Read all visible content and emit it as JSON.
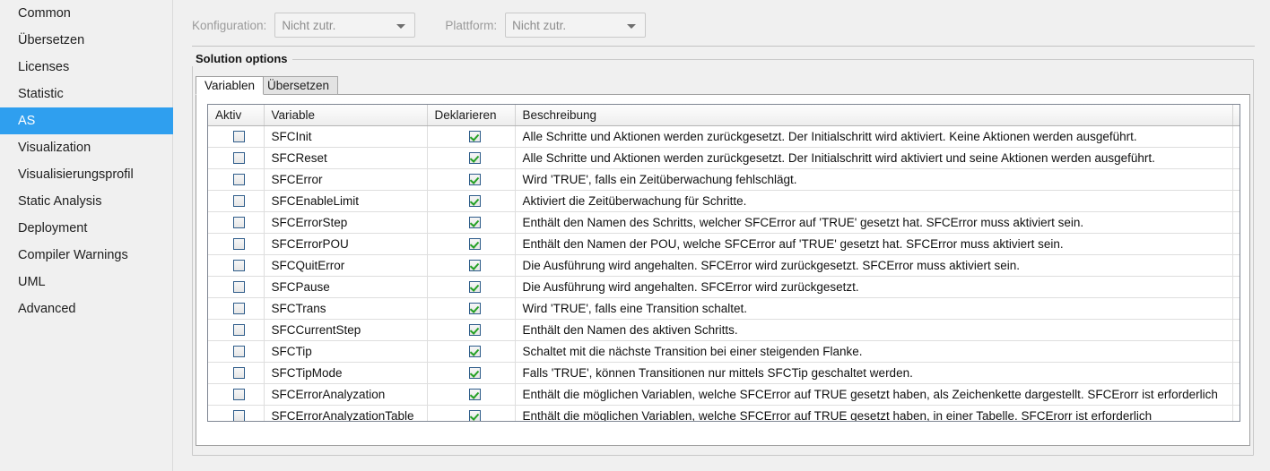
{
  "sidebar": {
    "items": [
      {
        "label": "Common",
        "selected": false
      },
      {
        "label": "Übersetzen",
        "selected": false
      },
      {
        "label": "Licenses",
        "selected": false
      },
      {
        "label": "Statistic",
        "selected": false
      },
      {
        "label": "AS",
        "selected": true
      },
      {
        "label": "Visualization",
        "selected": false
      },
      {
        "label": "Visualisierungsprofil",
        "selected": false
      },
      {
        "label": "Static Analysis",
        "selected": false
      },
      {
        "label": "Deployment",
        "selected": false
      },
      {
        "label": "Compiler Warnings",
        "selected": false
      },
      {
        "label": "UML",
        "selected": false
      },
      {
        "label": "Advanced",
        "selected": false
      }
    ],
    "selected_highlight_color": "#2f9fef"
  },
  "filterbar": {
    "konfiguration_label": "Konfiguration:",
    "konfiguration_value": "Nicht zutr.",
    "plattform_label": "Plattform:",
    "plattform_value": "Nicht zutr."
  },
  "groupbox": {
    "title": "Solution options"
  },
  "tabs": [
    {
      "label": "Variablen",
      "active": true
    },
    {
      "label": "Übersetzen",
      "active": false
    }
  ],
  "table": {
    "columns": [
      "Aktiv",
      "Variable",
      "Deklarieren",
      "Beschreibung"
    ],
    "rows": [
      {
        "aktiv": false,
        "deklarieren": true,
        "variable": "SFCInit",
        "beschreibung": "Alle Schritte und Aktionen werden zurückgesetzt. Der Initialschritt wird aktiviert. Keine Aktionen werden ausgeführt."
      },
      {
        "aktiv": false,
        "deklarieren": true,
        "variable": "SFCReset",
        "beschreibung": "Alle Schritte und Aktionen werden zurückgesetzt. Der Initialschritt wird aktiviert und seine Aktionen werden ausgeführt."
      },
      {
        "aktiv": false,
        "deklarieren": true,
        "variable": "SFCError",
        "beschreibung": "Wird 'TRUE', falls ein Zeitüberwachung fehlschlägt."
      },
      {
        "aktiv": false,
        "deklarieren": true,
        "variable": "SFCEnableLimit",
        "beschreibung": "Aktiviert die Zeitüberwachung für Schritte."
      },
      {
        "aktiv": false,
        "deklarieren": true,
        "variable": "SFCErrorStep",
        "beschreibung": "Enthält den Namen des Schritts, welcher SFCError auf 'TRUE' gesetzt hat. SFCError muss aktiviert sein."
      },
      {
        "aktiv": false,
        "deklarieren": true,
        "variable": "SFCErrorPOU",
        "beschreibung": "Enthält den Namen der POU, welche SFCError auf 'TRUE' gesetzt hat. SFCError muss aktiviert sein."
      },
      {
        "aktiv": false,
        "deklarieren": true,
        "variable": "SFCQuitError",
        "beschreibung": "Die Ausführung wird angehalten. SFCError wird zurückgesetzt. SFCError muss aktiviert sein."
      },
      {
        "aktiv": false,
        "deklarieren": true,
        "variable": "SFCPause",
        "beschreibung": "Die Ausführung wird angehalten. SFCError wird zurückgesetzt."
      },
      {
        "aktiv": false,
        "deklarieren": true,
        "variable": "SFCTrans",
        "beschreibung": "Wird 'TRUE', falls eine Transition schaltet."
      },
      {
        "aktiv": false,
        "deklarieren": true,
        "variable": "SFCCurrentStep",
        "beschreibung": "Enthält den Namen des aktiven Schritts."
      },
      {
        "aktiv": false,
        "deklarieren": true,
        "variable": "SFCTip",
        "beschreibung": "Schaltet mit die nächste Transition bei einer steigenden Flanke."
      },
      {
        "aktiv": false,
        "deklarieren": true,
        "variable": "SFCTipMode",
        "beschreibung": "Falls 'TRUE', können Transitionen nur mittels SFCTip geschaltet werden."
      },
      {
        "aktiv": false,
        "deklarieren": true,
        "variable": "SFCErrorAnalyzation",
        "beschreibung": "Enthält die möglichen Variablen, welche SFCError auf TRUE gesetzt haben, als Zeichenkette dargestellt. SFCErorr ist erforderlich"
      },
      {
        "aktiv": false,
        "deklarieren": true,
        "variable": "SFCErrorAnalyzationTable",
        "beschreibung": "Enthält die möglichen Variablen, welche SFCError auf TRUE gesetzt haben, in einer Tabelle. SFCErorr ist erforderlich"
      }
    ]
  }
}
